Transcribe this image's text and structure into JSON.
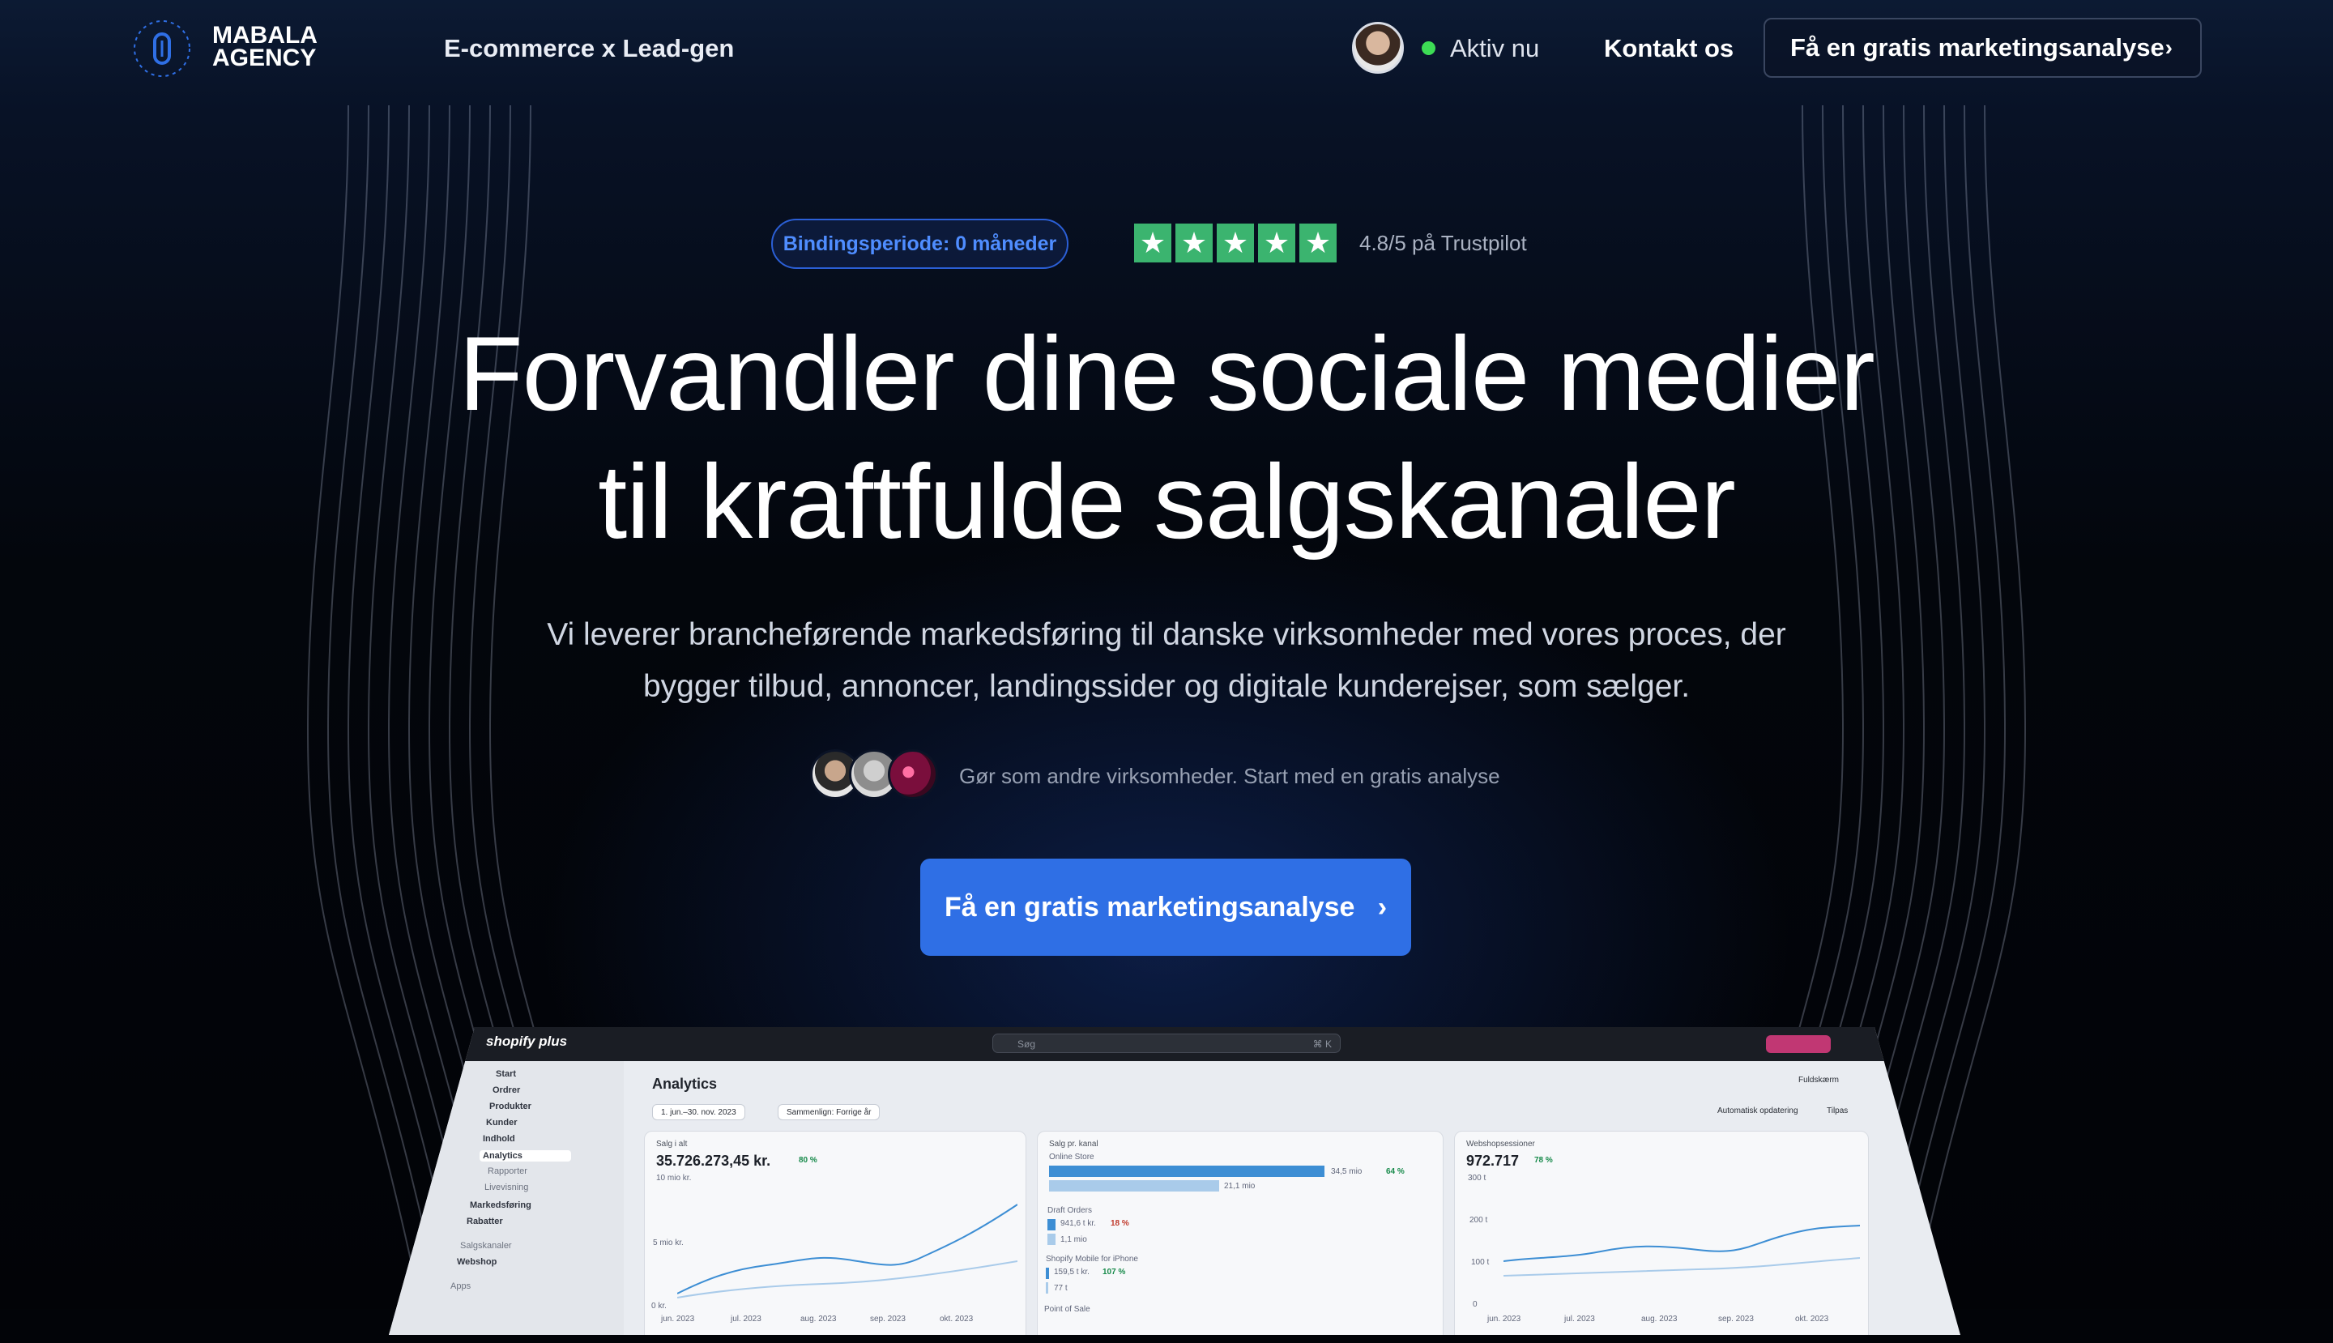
{
  "header": {
    "logo_ring_text": "AGENCY • MABALA •",
    "logo_line1": "MABALA",
    "logo_line2": "AGENCY",
    "tagline": "E-commerce x Lead-gen",
    "status": "Aktiv nu",
    "contact_label": "Kontakt os",
    "cta_label": "Få en gratis marketingsanalyse",
    "status_color": "#3ddc55"
  },
  "hero": {
    "badge": "Bindingsperiode: 0 måneder",
    "rating_text": "4.8/5 på Trustpilot",
    "stars": 5,
    "title_line1": "Forvandler dine sociale medier",
    "title_line2": "til kraftfulde salgskanaler",
    "subtitle_line1": "Vi leverer brancheførende markedsføring til danske virksomheder med vores proces, der",
    "subtitle_line2": "bygger tilbud, annoncer, landingssider og digitale kunderejser, som sælger.",
    "social_proof": "Gør som andre virksomheder. Start med en gratis analyse",
    "cta_label": "Få en gratis marketingsanalyse",
    "cta_color": "#2f6fe5",
    "trustpilot_color": "#3bb46f"
  },
  "dashboard": {
    "app_name": "shopify plus",
    "search_placeholder": "Søg",
    "search_shortcut": "⌘ K",
    "sidebar": [
      {
        "label": "Start"
      },
      {
        "label": "Ordrer"
      },
      {
        "label": "Produkter"
      },
      {
        "label": "Kunder"
      },
      {
        "label": "Indhold"
      },
      {
        "label": "Analytics"
      },
      {
        "label": "Rapporter"
      },
      {
        "label": "Livevisning"
      },
      {
        "label": "Markedsføring"
      },
      {
        "label": "Rabatter"
      },
      {
        "label": "Salgskanaler"
      },
      {
        "label": "Webshop"
      },
      {
        "label": "Apps"
      }
    ],
    "page_title": "Analytics",
    "date_range": "1. jun.–30. nov. 2023",
    "compare": "Sammenlign: Forrige år",
    "auto_update": "Automatisk opdatering",
    "customize": "Tilpas",
    "fullscreen": "Fuldskærm",
    "cards": [
      {
        "title": "Salg i alt",
        "value": "35.726.273,45 kr.",
        "delta": "80 %",
        "y_labels": [
          "10 mio kr.",
          "5 mio kr.",
          "0 kr."
        ],
        "x_labels": [
          "jun. 2023",
          "jul. 2023",
          "aug. 2023",
          "sep. 2023",
          "okt. 2023"
        ]
      },
      {
        "title": "Salg pr. kanal",
        "rows": [
          {
            "label": "Online Store",
            "value": "34,5 mio",
            "prev": "21,1 mio",
            "delta": "64 %"
          },
          {
            "label": "Draft Orders",
            "value": "941,6 t kr.",
            "prev": "1,1 mio",
            "delta": "18 %"
          },
          {
            "label": "Shopify Mobile for iPhone",
            "value": "159,5 t kr.",
            "prev": "77 t",
            "delta": "107 %"
          },
          {
            "label": "Point of Sale",
            "value": "",
            "prev": "",
            "delta": ""
          }
        ]
      },
      {
        "title": "Webshopsessioner",
        "value": "972.717",
        "delta": "78 %",
        "y_labels": [
          "300 t",
          "200 t",
          "100 t",
          "0"
        ],
        "x_labels": [
          "jun. 2023",
          "jul. 2023",
          "aug. 2023",
          "sep. 2023",
          "okt. 2023"
        ]
      }
    ]
  }
}
